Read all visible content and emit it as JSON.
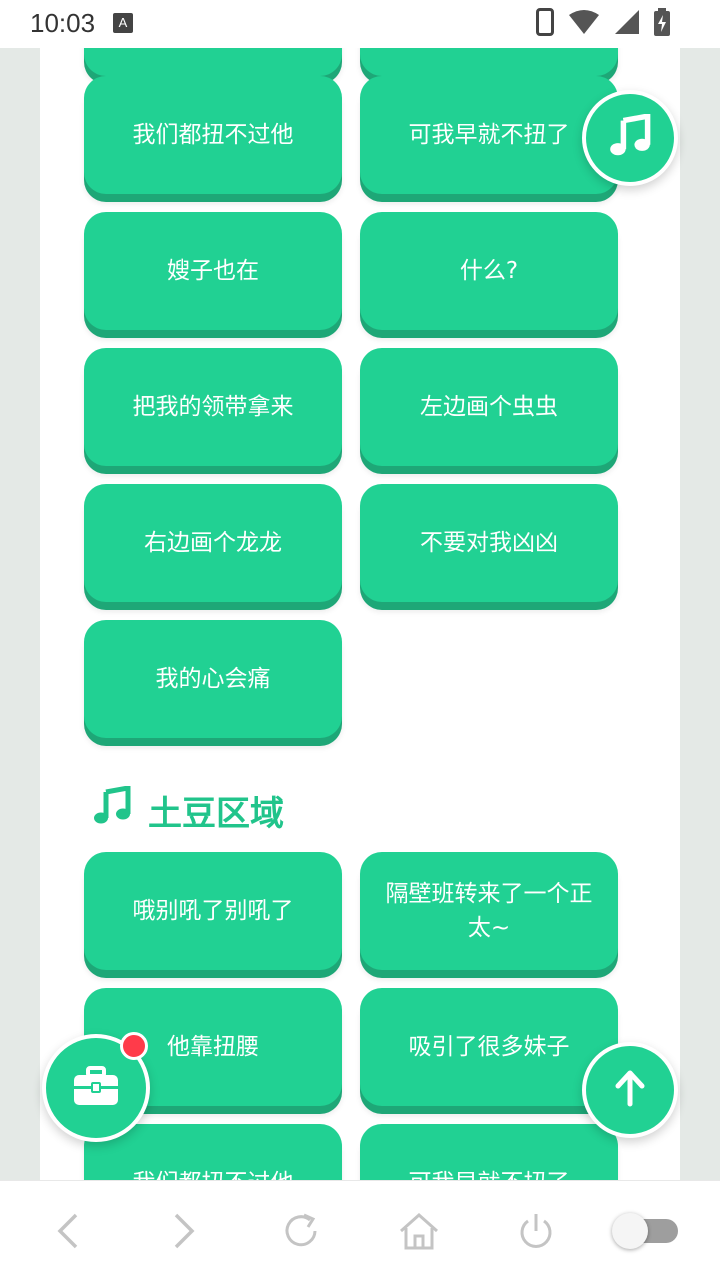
{
  "status_bar": {
    "time": "10:03",
    "notification_letter": "A"
  },
  "buttons": [
    {
      "label": ""
    },
    {
      "label": ""
    },
    {
      "label": "我们都扭不过他"
    },
    {
      "label": "可我早就不扭了"
    },
    {
      "label": "嫂子也在"
    },
    {
      "label": "什么?"
    },
    {
      "label": "把我的领带拿来"
    },
    {
      "label": "左边画个虫虫"
    },
    {
      "label": "右边画个龙龙"
    },
    {
      "label": "不要对我凶凶"
    },
    {
      "label": "我的心会痛"
    }
  ],
  "section": {
    "title": "土豆区域"
  },
  "section_buttons": [
    {
      "label": "哦别吼了别吼了"
    },
    {
      "label": "隔壁班转来了一个正太~"
    },
    {
      "label": "他靠扭腰"
    },
    {
      "label": "吸引了很多妹子"
    },
    {
      "label": "我们都扭不过他"
    },
    {
      "label": "可我早就不扭了"
    }
  ],
  "colors": {
    "accent": "#21d193",
    "accent_shadow": "#1ea777",
    "badge": "#ff3b4a"
  },
  "icons": {
    "music_fab": "music-note-icon",
    "toolbox_fab": "toolbox-icon",
    "scroll_top": "arrow-up-icon"
  }
}
